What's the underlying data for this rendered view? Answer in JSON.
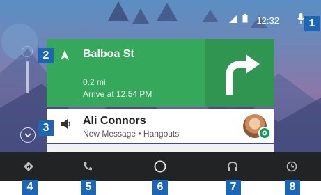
{
  "status": {
    "time": "12:32",
    "signal_icon": "cell-signal-icon",
    "battery_icon": "battery-icon",
    "mic_icon": "mic-icon"
  },
  "navigation_card": {
    "street": "Balboa St",
    "distance": "0.2 mi",
    "arrival": "Arrive at 12:54 PM",
    "direction_icon": "turn-right-arrow-icon",
    "color": "#36a85b"
  },
  "message_card": {
    "name": "Ali Connors",
    "detail": "New Message • Hangouts",
    "source_icon": "hangouts-icon",
    "audio_icon": "speaker-icon"
  },
  "bottom_nav": [
    {
      "icon": "navigation-icon"
    },
    {
      "icon": "phone-icon"
    },
    {
      "icon": "home-icon"
    },
    {
      "icon": "headphones-icon"
    },
    {
      "icon": "exit-icon"
    }
  ],
  "callouts": {
    "c1": "1",
    "c2": "2",
    "c3": "3",
    "c4": "4",
    "c5": "5",
    "c6": "6",
    "c7": "7",
    "c8": "8"
  },
  "colors": {
    "callout": "#1c66b5",
    "bar": "#222325",
    "accent": "#36a85b"
  }
}
